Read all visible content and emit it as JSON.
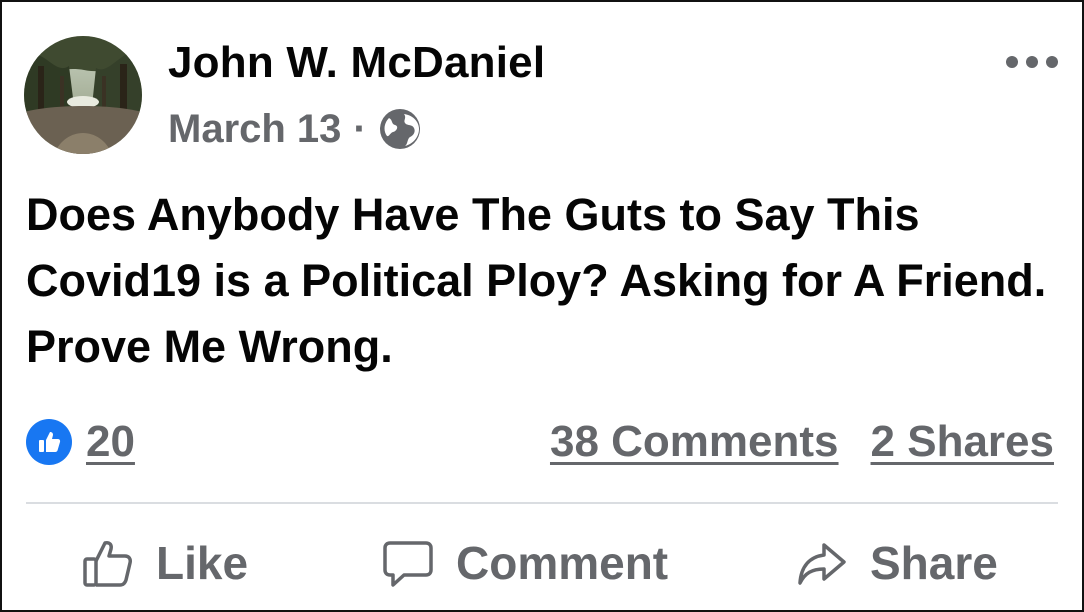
{
  "post": {
    "author": {
      "name": "John W. McDaniel",
      "avatar_icon": "tree-lined-path-avatar"
    },
    "date": "March 13",
    "separator": "·",
    "audience_icon": "globe-icon",
    "menu_icon": "more-options-icon",
    "text": "Does Anybody Have The Guts to Say This Covid19 is a Political Ploy? Asking for A Friend. Prove Me Wrong."
  },
  "stats": {
    "reaction_icon": "like-reaction-icon",
    "reactions": "20",
    "comments": "38 Comments",
    "shares": "2 Shares"
  },
  "actions": {
    "like": "Like",
    "comment": "Comment",
    "share": "Share"
  },
  "colors": {
    "text": "#050505",
    "secondary": "#65676b",
    "like_blue": "#1877f2",
    "divider": "#dadde1"
  }
}
